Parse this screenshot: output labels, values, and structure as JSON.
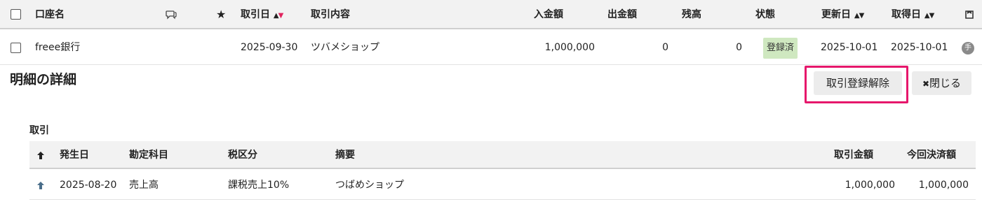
{
  "top_table": {
    "headers": {
      "account": "口座名",
      "trade_date": "取引日",
      "content": "取引内容",
      "deposit": "入金額",
      "withdrawal": "出金額",
      "balance": "残高",
      "status": "状態",
      "updated": "更新日",
      "acquired": "取得日"
    },
    "sort_up_glyph": "▲",
    "sort_down_glyph": "▼",
    "row": {
      "account": "freee銀行",
      "trade_date": "2025-09-30",
      "content": "ツバメショップ",
      "deposit": "1,000,000",
      "withdrawal": "0",
      "balance": "0",
      "status": "登録済",
      "updated": "2025-10-01",
      "acquired": "2025-10-01",
      "hand_badge": "手"
    }
  },
  "detail": {
    "title": "明細の詳細",
    "unregister_button": "取引登録解除",
    "close_button": "閉じる",
    "close_icon": "✖"
  },
  "trade_section": {
    "title": "取引",
    "headers": {
      "date": "発生日",
      "account_item": "勘定科目",
      "tax": "税区分",
      "summary": "摘要",
      "amount": "取引金額",
      "settled": "今回決済額"
    },
    "row": {
      "date": "2025-08-20",
      "account_item": "売上高",
      "tax": "課税売上10%",
      "summary": "つばめショップ",
      "amount": "1,000,000",
      "settled": "1,000,000"
    }
  },
  "colors": {
    "accent": "#e6176b",
    "status_bg": "#cfe8c0",
    "header_bg": "#f2f2f2"
  }
}
